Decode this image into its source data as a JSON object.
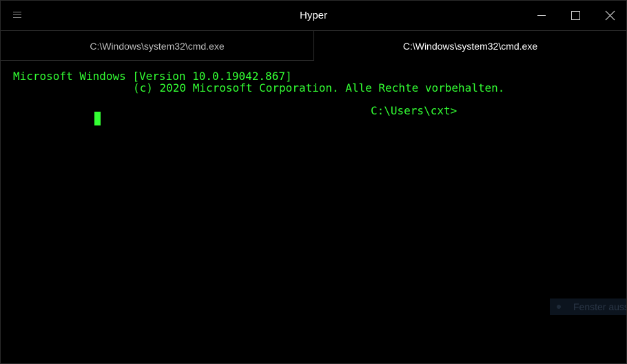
{
  "window": {
    "title": "Hyper"
  },
  "titlebar": {
    "menu_icon": "hamburger-menu-icon",
    "controls": {
      "minimize_icon": "minimize-icon",
      "maximize_icon": "maximize-icon",
      "close_icon": "close-icon"
    }
  },
  "tabs": [
    {
      "label": "C:\\Windows\\system32\\cmd.exe",
      "active": false
    },
    {
      "label": "C:\\Windows\\system32\\cmd.exe",
      "active": true
    }
  ],
  "terminal": {
    "lines": [
      "Microsoft Windows [Version 10.0.19042.867]",
      "(c) 2020 Microsoft Corporation. Alle Rechte vorbehalten.",
      "C:\\Users\\cxt>"
    ],
    "text_color": "#33ff33",
    "background": "#000000"
  },
  "notification": {
    "text": "Fenster auss",
    "icon": "notification-dot-icon"
  }
}
